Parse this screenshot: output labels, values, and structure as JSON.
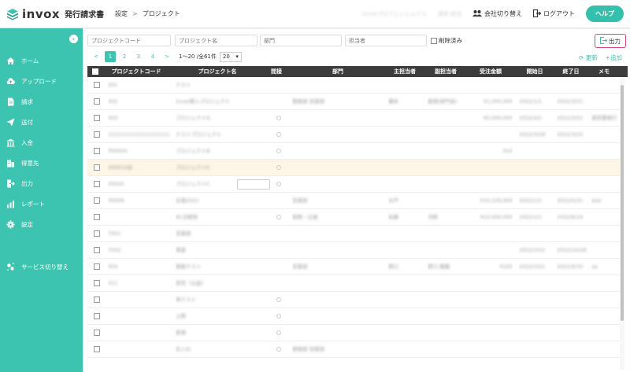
{
  "app": {
    "name": "invox",
    "subtitle": "発行請求書",
    "brand_color": "#3cc4b0",
    "accent_color": "#e0447a"
  },
  "breadcrumb": {
    "items": [
      "設定",
      "プロジェクト"
    ],
    "separator": ">"
  },
  "header": {
    "company": "invoxプロフェッショナル",
    "user": "請求 担当",
    "switch_company": "会社切り替え",
    "logout": "ログアウト",
    "help": "ヘルプ"
  },
  "sidebar": {
    "collapse_icon": "chevron-left-icon",
    "items": [
      {
        "label": "ホーム",
        "icon": "home-icon"
      },
      {
        "label": "アップロード",
        "icon": "cloud-upload-icon"
      },
      {
        "label": "請求",
        "icon": "document-icon"
      },
      {
        "label": "送付",
        "icon": "send-icon"
      },
      {
        "label": "入金",
        "icon": "bank-icon"
      },
      {
        "label": "得意先",
        "icon": "building-icon"
      },
      {
        "label": "出力",
        "icon": "export-icon"
      },
      {
        "label": "レポート",
        "icon": "chart-icon"
      },
      {
        "label": "設定",
        "icon": "gear-icon"
      }
    ],
    "service_switch": {
      "label": "サービス切り替え",
      "icon": "switch-icon"
    }
  },
  "filters": {
    "code_placeholder": "プロジェクトコード",
    "name_placeholder": "プロジェクト名",
    "dept_placeholder": "部門",
    "owner_placeholder": "担当者",
    "deleted_label": "削除済み",
    "export_label": "出力"
  },
  "pager": {
    "prev": "<",
    "next": ">",
    "pages": [
      "1",
      "2",
      "3",
      "4"
    ],
    "current": "1",
    "range": "1〜20 /全61件",
    "per_page": "20"
  },
  "actions": {
    "refresh": "更新",
    "add": "追加"
  },
  "table": {
    "columns": [
      "プロジェクトコード",
      "プロジェクト名",
      "間接",
      "部門",
      "主担当者",
      "副担当者",
      "受注金額",
      "開始日",
      "終了日",
      "メモ"
    ],
    "rows": [
      {
        "code": "001",
        "name": "テスト",
        "indirect": false,
        "dept": "",
        "main": "",
        "sub": "",
        "amount": "",
        "start": "",
        "end": "",
        "memo": ""
      },
      {
        "code": "002",
        "name": "invox導入プロジェクト",
        "indirect": false,
        "dept": "開発部 営業部",
        "main": "橋本",
        "sub": "経理(部門長)",
        "amount": "¥1,000,000",
        "start": "2022/1/1",
        "end": "2022/3/31",
        "memo": ""
      },
      {
        "code": "003",
        "name": "プロジェクトA",
        "indirect": true,
        "dept": "",
        "main": "",
        "sub": "",
        "amount": "¥5,000,000",
        "start": "2022/4/1",
        "end": "2022/3/31",
        "memo": "請求書発行 メモ"
      },
      {
        "code": "1111111111111111111",
        "name": "テストプロジェクト",
        "indirect": true,
        "dept": "",
        "main": "",
        "sub": "",
        "amount": "",
        "start": "2022/3/28",
        "end": "2022/3/25",
        "memo": ""
      },
      {
        "code": "P00004",
        "name": "プロジェクトB",
        "indirect": true,
        "dept": "",
        "main": "",
        "sub": "",
        "amount": "¥10",
        "start": "",
        "end": "",
        "memo": ""
      },
      {
        "code": "000014あ",
        "name": "プロジェクトE",
        "indirect": true,
        "dept": "",
        "main": "",
        "sub": "",
        "amount": "",
        "start": "",
        "end": "",
        "memo": ""
      },
      {
        "code": "00020",
        "name": "プロジェクトC",
        "indirect": true,
        "dept": "",
        "main": "",
        "sub": "",
        "amount": "",
        "start": "",
        "end": "",
        "memo": ""
      },
      {
        "code": "00006",
        "name": "広報2022",
        "indirect": false,
        "dept": "営業部",
        "main": "水戸",
        "sub": "",
        "amount": "¥10,229,900",
        "start": "2022/1/1",
        "end": "2022/5/31",
        "memo": "test"
      },
      {
        "code": "",
        "name": "KC法務部",
        "indirect": true,
        "dept": "財務・企画",
        "main": "佐藤",
        "sub": "河原",
        "amount": "¥10,000,000",
        "start": "2022/1/1",
        "end": "2022/6/16",
        "memo": ""
      },
      {
        "code": "T001",
        "name": "営業部",
        "indirect": false,
        "dept": "",
        "main": "",
        "sub": "",
        "amount": "",
        "start": "",
        "end": "",
        "memo": ""
      },
      {
        "code": "T002",
        "name": "事業",
        "indirect": false,
        "dept": "",
        "main": "",
        "sub": "",
        "amount": "",
        "start": "2022/10/1",
        "end": "2022/10/28",
        "memo": ""
      },
      {
        "code": "004",
        "name": "開発テスト",
        "indirect": false,
        "dept": "営業部",
        "main": "野口",
        "sub": "野口 勝義",
        "amount": "¥100",
        "start": "2022/10/1",
        "end": "2022/9/30",
        "memo": "aa"
      },
      {
        "code": "011",
        "name": "研究（公益）",
        "indirect": false,
        "dept": "",
        "main": "",
        "sub": "",
        "amount": "",
        "start": "",
        "end": "",
        "memo": ""
      },
      {
        "code": "",
        "name": "単テスト",
        "indirect": true,
        "dept": "",
        "main": "",
        "sub": "",
        "amount": "",
        "start": "",
        "end": "",
        "memo": ""
      },
      {
        "code": "",
        "name": "上野",
        "indirect": true,
        "dept": "",
        "main": "",
        "sub": "",
        "amount": "",
        "start": "",
        "end": "",
        "memo": ""
      },
      {
        "code": "",
        "name": "新規",
        "indirect": true,
        "dept": "",
        "main": "",
        "sub": "",
        "amount": "",
        "start": "",
        "end": "",
        "memo": ""
      },
      {
        "code": "",
        "name": "社入れ",
        "indirect": true,
        "dept": "開発部 営業部",
        "main": "",
        "sub": "",
        "amount": "",
        "start": "",
        "end": "",
        "memo": ""
      }
    ],
    "highlight_row": 5,
    "row_button_row": 6
  }
}
